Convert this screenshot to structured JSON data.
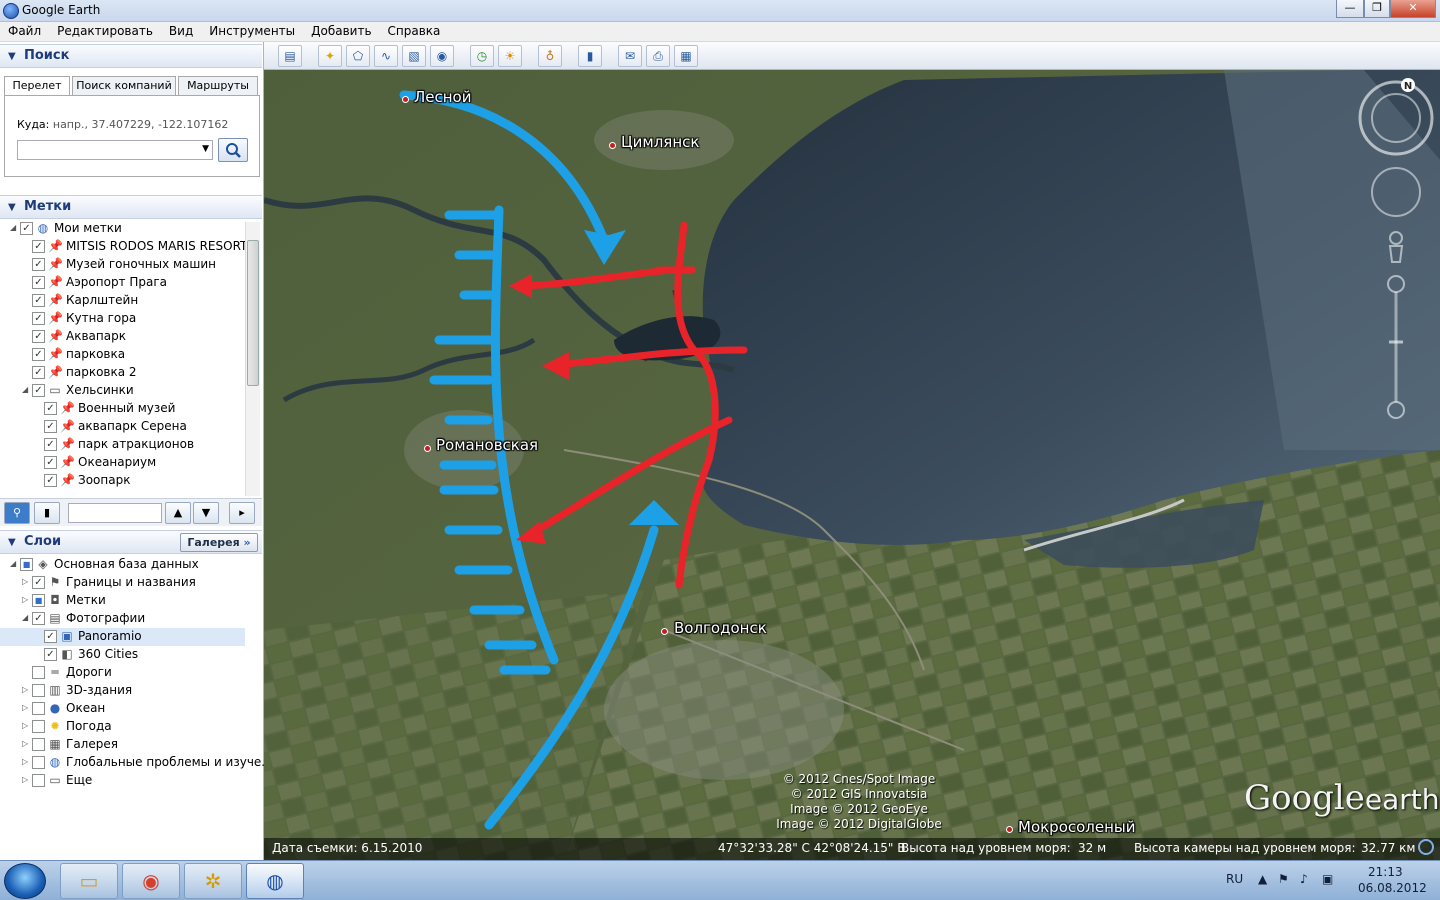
{
  "window": {
    "title": "Google Earth",
    "controls": [
      "—",
      "❐",
      "✕"
    ]
  },
  "menu": [
    "Файл",
    "Редактировать",
    "Вид",
    "Инструменты",
    "Добавить",
    "Справка"
  ],
  "search_panel": {
    "title": "Поиск",
    "tabs": [
      "Перелет",
      "Поиск компаний",
      "Маршруты"
    ],
    "to_label": "Куда:",
    "to_hint": "напр., 37.407229, -122.107162",
    "input_value": ""
  },
  "places_panel": {
    "title": "Метки",
    "items": [
      {
        "label": "Мои метки",
        "level": 0,
        "checked": true,
        "icon": "globe-icon",
        "expander": "◢"
      },
      {
        "label": "MITSIS RODOS MARIS RESORT...",
        "level": 1,
        "checked": true,
        "icon": "pushpin-icon"
      },
      {
        "label": "Музей гоночных машин",
        "level": 1,
        "checked": true,
        "icon": "pushpin-icon"
      },
      {
        "label": "Аэропорт Прага",
        "level": 1,
        "checked": true,
        "icon": "pushpin-icon"
      },
      {
        "label": "Карлштейн",
        "level": 1,
        "checked": true,
        "icon": "pushpin-icon"
      },
      {
        "label": "Кутна гора",
        "level": 1,
        "checked": true,
        "icon": "pushpin-icon"
      },
      {
        "label": "Аквапарк",
        "level": 1,
        "checked": true,
        "icon": "pushpin-icon"
      },
      {
        "label": "парковка",
        "level": 1,
        "checked": true,
        "icon": "pushpin-icon"
      },
      {
        "label": "парковка 2",
        "level": 1,
        "checked": true,
        "icon": "pushpin-icon"
      },
      {
        "label": "Хельсинки",
        "level": 1,
        "checked": true,
        "icon": "folder-icon",
        "expander": "◢"
      },
      {
        "label": "Военный музей",
        "level": 2,
        "checked": true,
        "icon": "pushpin-icon"
      },
      {
        "label": "аквапарк Серена",
        "level": 2,
        "checked": true,
        "icon": "pushpin-icon"
      },
      {
        "label": "парк атракционов",
        "level": 2,
        "checked": true,
        "icon": "pushpin-icon"
      },
      {
        "label": "Океанариум",
        "level": 2,
        "checked": true,
        "icon": "pushpin-icon"
      },
      {
        "label": "Зоопарк",
        "level": 2,
        "checked": true,
        "icon": "pushpin-icon"
      }
    ]
  },
  "layers_panel": {
    "title": "Слои",
    "gallery_button": "Галерея",
    "items": [
      {
        "label": "Основная база данных",
        "level": 0,
        "checked": "partial",
        "icon": "database-icon",
        "expander": "◢"
      },
      {
        "label": "Границы и названия",
        "level": 1,
        "checked": true,
        "icon": "flag-icon",
        "expander": "▷"
      },
      {
        "label": "Метки",
        "level": 1,
        "checked": "partial",
        "icon": "placemark-icon",
        "expander": "▷"
      },
      {
        "label": "Фотографии",
        "level": 1,
        "checked": true,
        "icon": "photo-icon",
        "expander": "◢"
      },
      {
        "label": "Panoramio",
        "level": 2,
        "checked": true,
        "icon": "panoramio-icon",
        "selected": true
      },
      {
        "label": "360 Cities",
        "level": 2,
        "checked": true,
        "icon": "cities-icon"
      },
      {
        "label": "Дороги",
        "level": 1,
        "checked": false,
        "icon": "road-icon"
      },
      {
        "label": "3D-здания",
        "level": 1,
        "checked": false,
        "icon": "building-icon",
        "expander": "▷"
      },
      {
        "label": "Океан",
        "level": 1,
        "checked": false,
        "icon": "ocean-icon",
        "expander": "▷"
      },
      {
        "label": "Погода",
        "level": 1,
        "checked": false,
        "icon": "weather-icon",
        "expander": "▷"
      },
      {
        "label": "Галерея",
        "level": 1,
        "checked": false,
        "icon": "gallery-icon",
        "expander": "▷"
      },
      {
        "label": "Глобальные проблемы и изуче...",
        "level": 1,
        "checked": false,
        "icon": "globe-icon",
        "expander": "▷"
      },
      {
        "label": "Еще",
        "level": 1,
        "checked": false,
        "icon": "folder-icon",
        "expander": "▷"
      }
    ]
  },
  "map": {
    "places": [
      {
        "label": "Лесной"
      },
      {
        "label": "Цимлянск"
      },
      {
        "label": "Романовская"
      },
      {
        "label": "Волгодонск"
      },
      {
        "label": "Мокросоленый"
      }
    ],
    "credits": [
      "© 2012 Cnes/Spot Image",
      "© 2012 GIS Innovatsia",
      "Image © 2012 GeoEye",
      "Image © 2012 DigitalGlobe"
    ],
    "logo": {
      "main": "Google",
      "sub": "earth"
    },
    "compass_letter": "N"
  },
  "status": {
    "imagery_date": "Дата съемки: 6.15.2010",
    "coordinates": "47°32'33.28\" С  42°08'24.15\" В",
    "elevation_label": "Высота над уровнем моря:",
    "elevation_value": "32 м",
    "eye_alt_label": "Высота камеры над уровнем моря:",
    "eye_alt_value": "32.77 км"
  },
  "taskbar": {
    "language": "RU",
    "time": "21:13",
    "date": "06.08.2012"
  },
  "colors": {
    "annotation_red": "#e8242a",
    "annotation_blue": "#1ea0e6",
    "water": "#2a3b4f"
  }
}
